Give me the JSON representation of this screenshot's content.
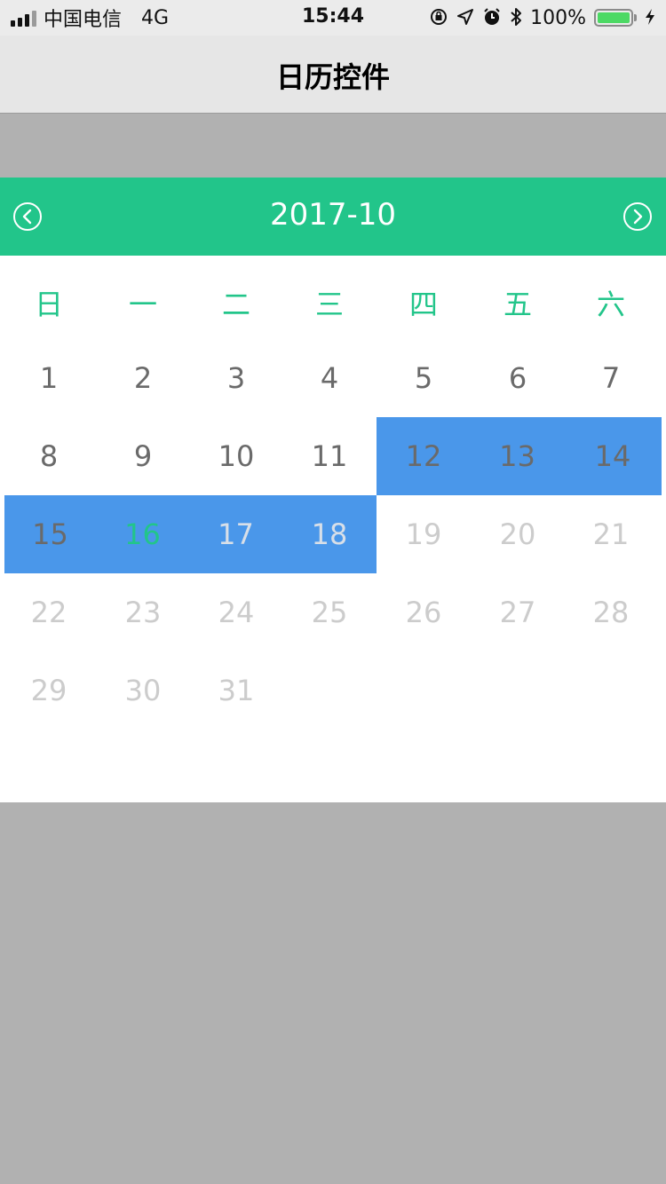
{
  "status_bar": {
    "carrier": "中国电信",
    "network": "4G",
    "time": "15:44",
    "battery_percent": "100%",
    "icons": [
      "orientation-lock-icon",
      "location-icon",
      "alarm-icon",
      "bluetooth-icon",
      "charging-icon"
    ]
  },
  "nav": {
    "title": "日历控件"
  },
  "calendar": {
    "month_label": "2017-10",
    "prev_icon": "chevron-left-circle-icon",
    "next_icon": "chevron-right-circle-icon",
    "weekdays": [
      "日",
      "一",
      "二",
      "三",
      "四",
      "五",
      "六"
    ],
    "first_weekday_index": 0,
    "days_in_month": 31,
    "today": 16,
    "range_start": 12,
    "range_end": 18,
    "colors": {
      "accent": "#22c58a",
      "selection": "#4a97ea",
      "past_text": "#6a6a6a",
      "future_text": "#cccccc",
      "backdrop": "#b1b1b1"
    }
  }
}
